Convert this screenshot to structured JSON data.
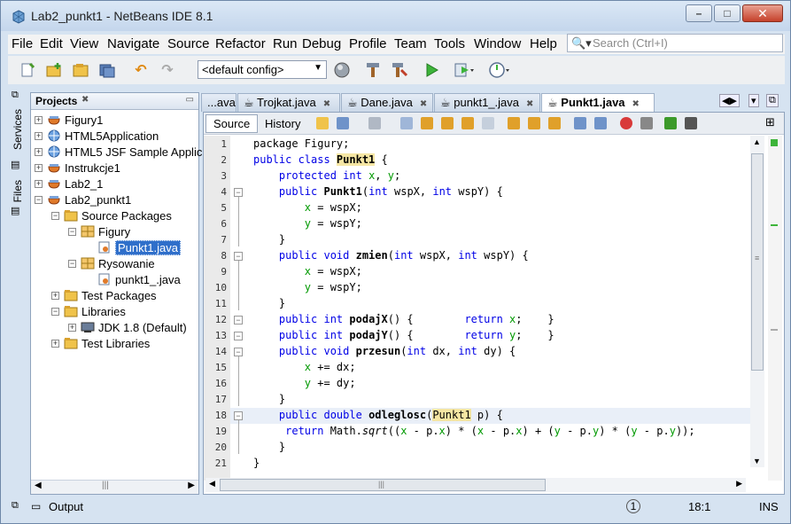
{
  "window": {
    "title": "Lab2_punkt1 - NetBeans IDE 8.1",
    "buttons": [
      "–",
      "□",
      "✕"
    ]
  },
  "menu": [
    "File",
    "Edit",
    "View",
    "Navigate",
    "Source",
    "Refactor",
    "Run",
    "Debug",
    "Profile",
    "Team",
    "Tools",
    "Window",
    "Help"
  ],
  "search": {
    "placeholder": "Search (Ctrl+I)",
    "icon": "search-icon"
  },
  "toolbar": {
    "config": "<default config>"
  },
  "side_tabs": [
    "Services",
    "Files"
  ],
  "projects": {
    "title": "Projects",
    "tree": [
      {
        "label": "Figury1",
        "depth": 0,
        "toggle": "+",
        "icon": "project-icon"
      },
      {
        "label": "HTML5Application",
        "depth": 0,
        "toggle": "+",
        "icon": "globe-icon"
      },
      {
        "label": "HTML5 JSF Sample Applic",
        "depth": 0,
        "toggle": "+",
        "icon": "globe-icon"
      },
      {
        "label": "Instrukcje1",
        "depth": 0,
        "toggle": "+",
        "icon": "project-icon"
      },
      {
        "label": "Lab2_1",
        "depth": 0,
        "toggle": "+",
        "icon": "project-icon"
      },
      {
        "label": "Lab2_punkt1",
        "depth": 0,
        "toggle": "−",
        "icon": "project-icon"
      },
      {
        "label": "Source Packages",
        "depth": 1,
        "toggle": "−",
        "icon": "folder-icon"
      },
      {
        "label": "Figury",
        "depth": 2,
        "toggle": "−",
        "icon": "package-icon"
      },
      {
        "label": "Punkt1.java",
        "depth": 3,
        "toggle": "",
        "icon": "java-file-icon",
        "selected": true
      },
      {
        "label": "Rysowanie",
        "depth": 2,
        "toggle": "−",
        "icon": "package-icon"
      },
      {
        "label": "punkt1_.java",
        "depth": 3,
        "toggle": "",
        "icon": "java-file-icon"
      },
      {
        "label": "Test Packages",
        "depth": 1,
        "toggle": "+",
        "icon": "folder-icon"
      },
      {
        "label": "Libraries",
        "depth": 1,
        "toggle": "−",
        "icon": "folder-icon"
      },
      {
        "label": "JDK 1.8 (Default)",
        "depth": 2,
        "toggle": "+",
        "icon": "jdk-icon"
      },
      {
        "label": "Test Libraries",
        "depth": 1,
        "toggle": "+",
        "icon": "folder-icon"
      }
    ]
  },
  "editor": {
    "tabs": [
      {
        "label": "...ava",
        "active": false
      },
      {
        "label": "Trojkat.java",
        "active": false
      },
      {
        "label": "Dane.java",
        "active": false
      },
      {
        "label": "punkt1_.java",
        "active": false
      },
      {
        "label": "Punkt1.java",
        "active": true
      }
    ],
    "source_label": "Source",
    "history_label": "History",
    "line_numbers": [
      "1",
      "2",
      "3",
      "4",
      "5",
      "6",
      "7",
      "8",
      "9",
      "10",
      "11",
      "12",
      "13",
      "14",
      "15",
      "16",
      "17",
      "18",
      "19",
      "20",
      "21"
    ],
    "code": [
      [
        {
          "t": "package Figury;"
        }
      ],
      [
        {
          "t": "public class ",
          "c": "kw"
        },
        {
          "t": "Punkt1",
          "c": "cls meth"
        },
        {
          "t": " {"
        }
      ],
      [
        {
          "t": "    "
        },
        {
          "t": "protected int ",
          "c": "kw"
        },
        {
          "t": "x",
          "c": "fld"
        },
        {
          "t": ", "
        },
        {
          "t": "y",
          "c": "fld"
        },
        {
          "t": ";"
        }
      ],
      [
        {
          "t": "    "
        },
        {
          "t": "public ",
          "c": "kw"
        },
        {
          "t": "Punkt1",
          "c": "meth"
        },
        {
          "t": "("
        },
        {
          "t": "int",
          "c": "kw"
        },
        {
          "t": " wspX, "
        },
        {
          "t": "int",
          "c": "kw"
        },
        {
          "t": " wspY) {"
        }
      ],
      [
        {
          "t": "        "
        },
        {
          "t": "x",
          "c": "fld"
        },
        {
          "t": " = wspX;"
        }
      ],
      [
        {
          "t": "        "
        },
        {
          "t": "y",
          "c": "fld"
        },
        {
          "t": " = wspY;"
        }
      ],
      [
        {
          "t": "    }"
        }
      ],
      [
        {
          "t": "    "
        },
        {
          "t": "public void ",
          "c": "kw"
        },
        {
          "t": "zmien",
          "c": "meth"
        },
        {
          "t": "("
        },
        {
          "t": "int",
          "c": "kw"
        },
        {
          "t": " wspX, "
        },
        {
          "t": "int",
          "c": "kw"
        },
        {
          "t": " wspY) {"
        }
      ],
      [
        {
          "t": "        "
        },
        {
          "t": "x",
          "c": "fld"
        },
        {
          "t": " = wspX;"
        }
      ],
      [
        {
          "t": "        "
        },
        {
          "t": "y",
          "c": "fld"
        },
        {
          "t": " = wspY;"
        }
      ],
      [
        {
          "t": "    }"
        }
      ],
      [
        {
          "t": "    "
        },
        {
          "t": "public int ",
          "c": "kw"
        },
        {
          "t": "podajX",
          "c": "meth"
        },
        {
          "t": "() {        "
        },
        {
          "t": "return ",
          "c": "kw"
        },
        {
          "t": "x",
          "c": "fld"
        },
        {
          "t": ";    }"
        }
      ],
      [
        {
          "t": "    "
        },
        {
          "t": "public int ",
          "c": "kw"
        },
        {
          "t": "podajY",
          "c": "meth"
        },
        {
          "t": "() {        "
        },
        {
          "t": "return ",
          "c": "kw"
        },
        {
          "t": "y",
          "c": "fld"
        },
        {
          "t": ";    }"
        }
      ],
      [
        {
          "t": "    "
        },
        {
          "t": "public void ",
          "c": "kw"
        },
        {
          "t": "przesun",
          "c": "meth"
        },
        {
          "t": "("
        },
        {
          "t": "int",
          "c": "kw"
        },
        {
          "t": " dx, "
        },
        {
          "t": "int",
          "c": "kw"
        },
        {
          "t": " dy) {"
        }
      ],
      [
        {
          "t": "        "
        },
        {
          "t": "x",
          "c": "fld"
        },
        {
          "t": " += dx;"
        }
      ],
      [
        {
          "t": "        "
        },
        {
          "t": "y",
          "c": "fld"
        },
        {
          "t": " += dy;"
        }
      ],
      [
        {
          "t": "    }"
        }
      ],
      [
        {
          "t": "    "
        },
        {
          "t": "public double ",
          "c": "kw"
        },
        {
          "t": "odleglosc",
          "c": "meth"
        },
        {
          "t": "("
        },
        {
          "t": "Punkt1",
          "c": "cls"
        },
        {
          "t": " p) {"
        }
      ],
      [
        {
          "t": "     "
        },
        {
          "t": "return ",
          "c": "kw"
        },
        {
          "t": "Math."
        },
        {
          "t": "sqrt",
          "c": "it"
        },
        {
          "t": "(("
        },
        {
          "t": "x",
          "c": "fld"
        },
        {
          "t": " - p."
        },
        {
          "t": "x",
          "c": "fld"
        },
        {
          "t": ") * ("
        },
        {
          "t": "x",
          "c": "fld"
        },
        {
          "t": " - p."
        },
        {
          "t": "x",
          "c": "fld"
        },
        {
          "t": ") + ("
        },
        {
          "t": "y",
          "c": "fld"
        },
        {
          "t": " - p."
        },
        {
          "t": "y",
          "c": "fld"
        },
        {
          "t": ") * ("
        },
        {
          "t": "y",
          "c": "fld"
        },
        {
          "t": " - p."
        },
        {
          "t": "y",
          "c": "fld"
        },
        {
          "t": "));"
        }
      ],
      [
        {
          "t": "    }"
        }
      ],
      [
        {
          "t": "}"
        }
      ]
    ]
  },
  "status": {
    "output": "Output",
    "position": "18:1",
    "mode": "INS"
  }
}
